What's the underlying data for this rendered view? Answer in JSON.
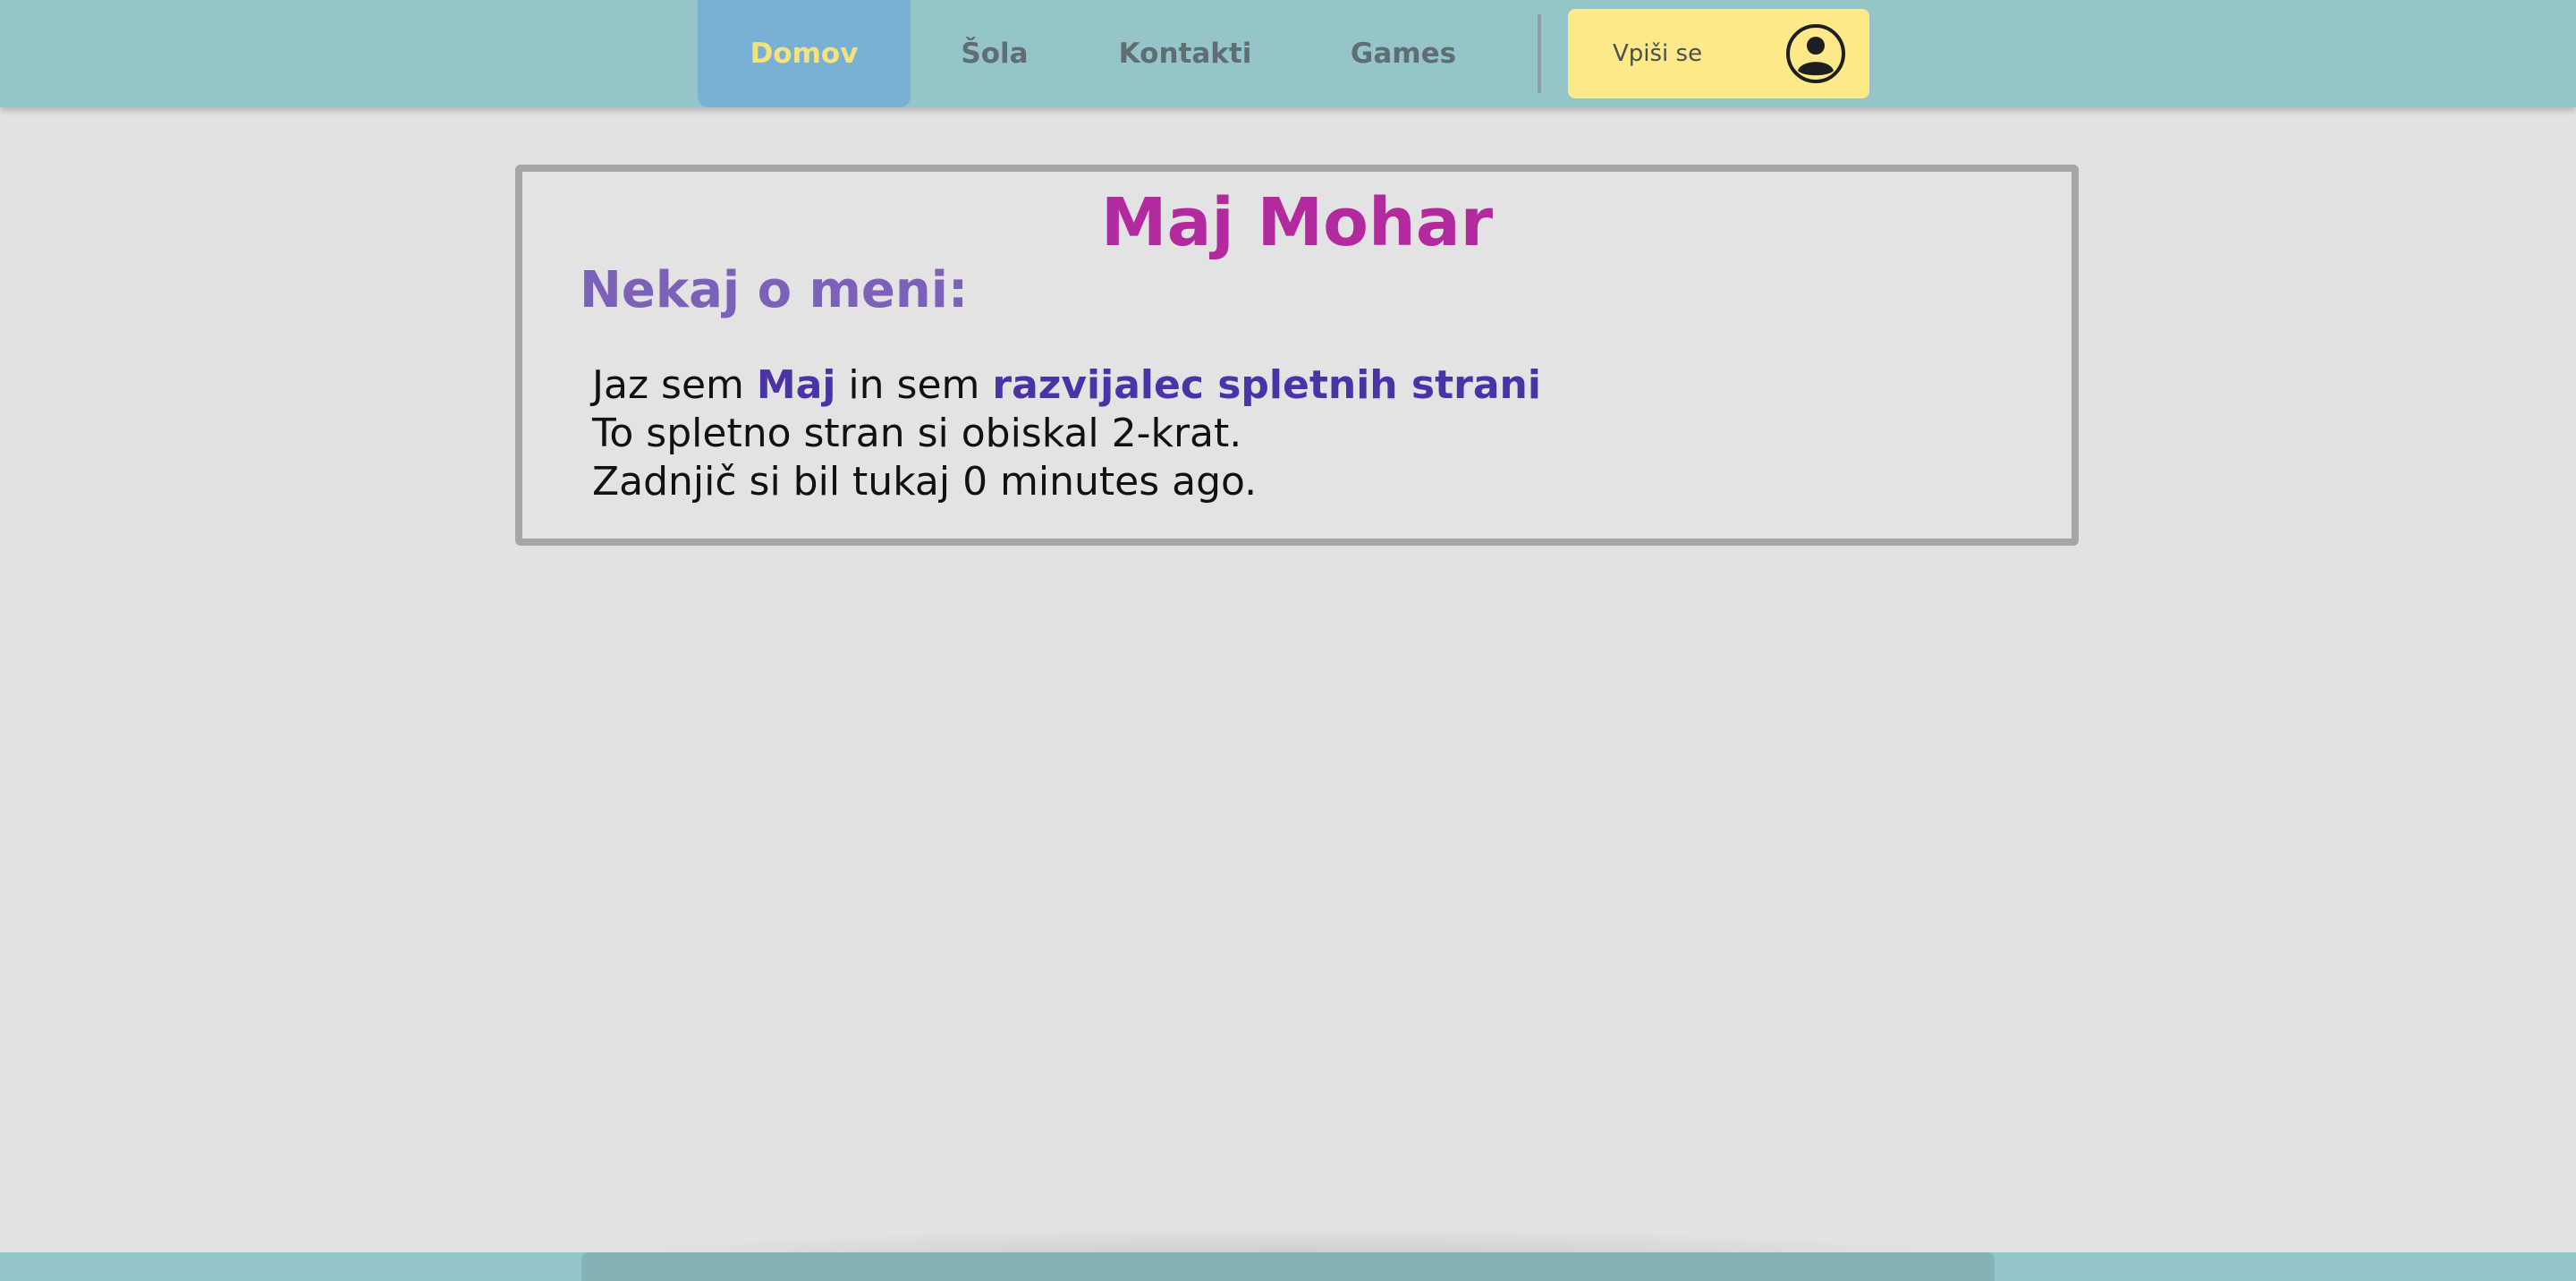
{
  "nav": {
    "items": [
      {
        "label": "Domov",
        "active": true
      },
      {
        "label": "Šola"
      },
      {
        "label": "Kontakti"
      },
      {
        "label": "Games"
      }
    ],
    "login_label": "Vpiši se",
    "login_icon": "user-circle-icon"
  },
  "card": {
    "title": "Maj Mohar",
    "subtitle": "Nekaj o meni:",
    "intro_prefix": "Jaz sem ",
    "name": "Maj",
    "intro_middle": " in sem ",
    "role": "razvijalec spletnih strani",
    "visits_line": "To spletno stran si obiskal 2-krat.",
    "last_visit_line": "Zadnjič si bil tukaj 0 minutes ago."
  },
  "colors": {
    "navbar": "#95c4c9",
    "active_tab": "#79b0d6",
    "active_text": "#f6e27a",
    "login_bg": "#fde88a",
    "title": "#b22a9e",
    "subtitle": "#7b61b7",
    "highlight": "#4a33a6"
  }
}
